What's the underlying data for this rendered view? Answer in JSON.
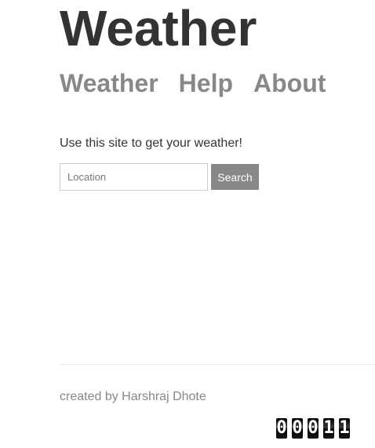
{
  "header": {
    "title": "Weather",
    "nav": [
      {
        "label": "Weather"
      },
      {
        "label": "Help"
      },
      {
        "label": "About"
      }
    ]
  },
  "main": {
    "intro": "Use this site to get your weather!",
    "search": {
      "placeholder": "Location",
      "value": "",
      "button_label": "Search"
    }
  },
  "footer": {
    "credit": "created by Harshraj Dhote",
    "counter_digits": [
      "0",
      "0",
      "0",
      "1",
      "1"
    ]
  },
  "colors": {
    "title": "#333333",
    "nav": "#888888",
    "button_bg": "#888888",
    "button_text": "#ffffff",
    "footer_text": "#888888"
  }
}
